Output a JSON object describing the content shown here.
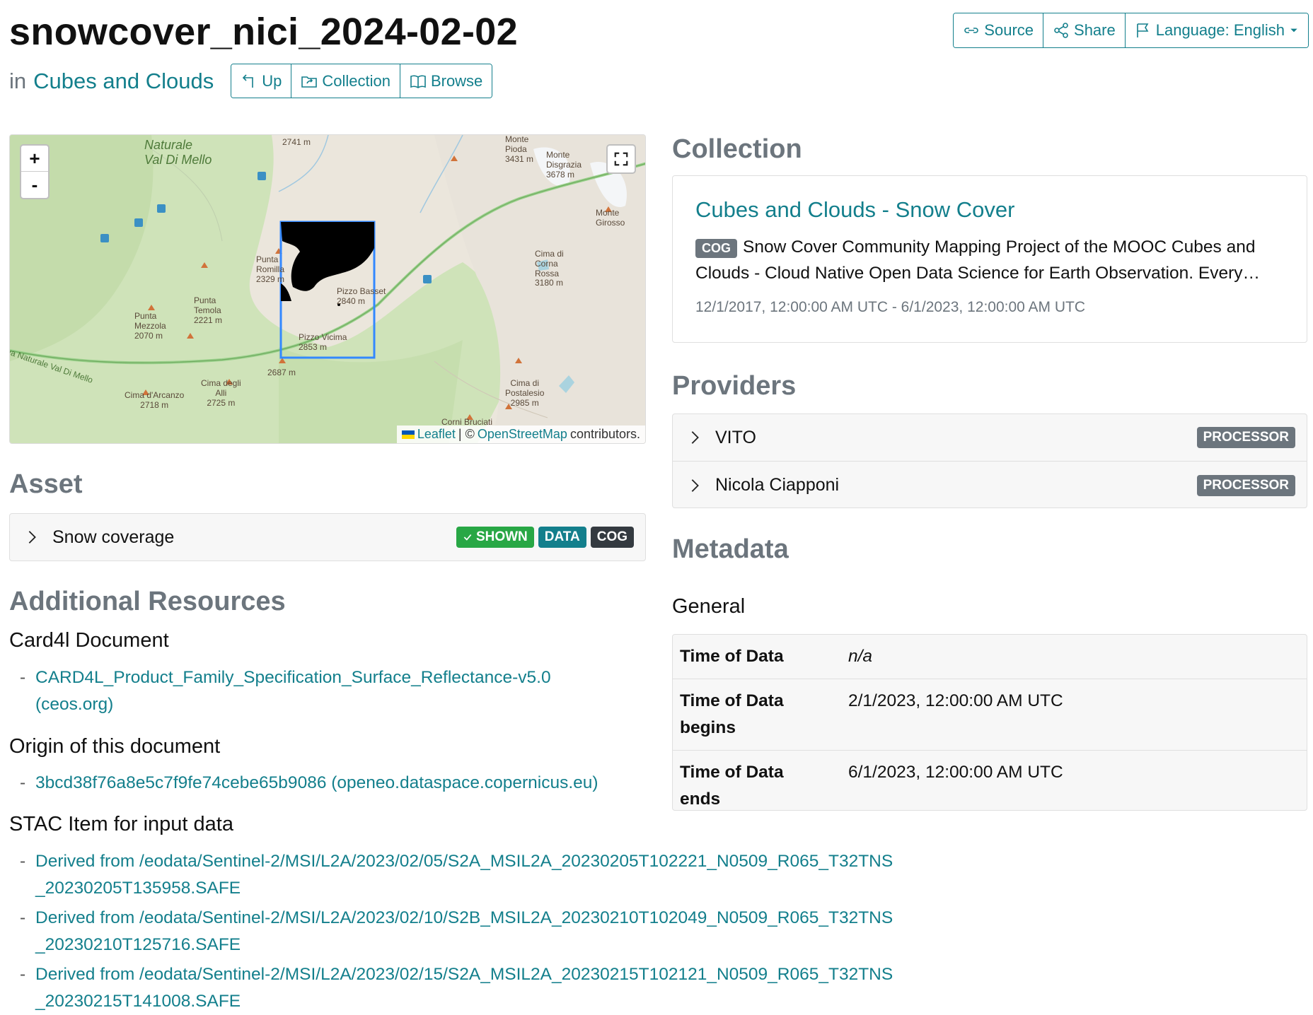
{
  "header": {
    "title": "snowcover_nici_2024-02-02",
    "in_label": "in",
    "catalog_link": "Cubes and Clouds",
    "nav": {
      "up": "Up",
      "collection": "Collection",
      "browse": "Browse"
    },
    "actions": {
      "source": "Source",
      "share": "Share",
      "language": "Language: English"
    }
  },
  "map": {
    "zoom_in": "+",
    "zoom_out": "-",
    "attribution": {
      "leaflet": "Leaflet",
      "separator": "| ©",
      "osm": "OpenStreetMap",
      "suffix": "contributors."
    },
    "labels": {
      "reserve": "Naturale\nVal Di Mello",
      "l2741": "2741 m",
      "piodaName": "Monte\nPioda",
      "pioda": "3431 m",
      "disgrazia": "Monte\nDisgrazia\n3678 m",
      "girosso": "Monte\nGirosso",
      "romilla": "Punta\nRomilla\n2329 m",
      "temola": "Punta\nTemola\n2221 m",
      "mezzola": "Punta\nMezzola\n2070 m",
      "basset": "Pizzo Basset\n2840 m",
      "vicima": "Pizzo Vicima\n2853 m",
      "corna": "Cima di\nCorna\nRossa\n3180 m",
      "riserva": "va Naturale Val Di Mello",
      "l2687": "2687 m",
      "arcanzo": "Cima d'Arcanzo\n2718 m",
      "alli": "Cima degli\nAlli\n2725 m",
      "postalesio": "Cima di\nPostalesio\n2985 m",
      "bruciati": "Corni Bruciati"
    }
  },
  "asset": {
    "heading": "Asset",
    "name": "Snow coverage",
    "badges": {
      "shown": "SHOWN",
      "data": "DATA",
      "cog": "COG"
    }
  },
  "resources": {
    "heading": "Additional Resources",
    "card4l": {
      "title": "Card4l Document",
      "link": "CARD4L_Product_Family_Specification_Surface_Reflectance-v5.0 (ceos.org)"
    },
    "origin": {
      "title": "Origin of this document",
      "link": "3bcd38f76a8e5c7f9fe74cebe65b9086 (openeo.dataspace.copernicus.eu)"
    },
    "stac": {
      "title": "STAC Item for input data",
      "links": [
        "Derived from /eodata/Sentinel-2/MSI/L2A/2023/02/05/S2A_MSIL2A_20230205T102221_N0509_R065_T32TNS_20230205T135958.SAFE",
        "Derived from /eodata/Sentinel-2/MSI/L2A/2023/02/10/S2B_MSIL2A_20230210T102049_N0509_R065_T32TNS_20230210T125716.SAFE",
        "Derived from /eodata/Sentinel-2/MSI/L2A/2023/02/15/S2A_MSIL2A_20230215T102121_N0509_R065_T32TNS_20230215T141008.SAFE"
      ]
    }
  },
  "collection": {
    "heading": "Collection",
    "title": "Cubes and Clouds - Snow Cover",
    "badge": "COG",
    "description": "Snow Cover Community Mapping Project of the MOOC Cubes and Clouds - Cloud Native Open Data Science for Earth Observation. Every…",
    "time_range": "12/1/2017, 12:00:00 AM UTC - 6/1/2023, 12:00:00 AM UTC"
  },
  "providers": {
    "heading": "Providers",
    "items": [
      {
        "name": "VITO",
        "role": "PROCESSOR"
      },
      {
        "name": "Nicola Ciapponi",
        "role": "PROCESSOR"
      }
    ]
  },
  "metadata": {
    "heading": "Metadata",
    "group": "General",
    "rows": [
      {
        "key": "Time of Data",
        "value": "n/a"
      },
      {
        "key": "Time of Data begins",
        "value": "2/1/2023, 12:00:00 AM UTC"
      },
      {
        "key": "Time of Data ends",
        "value": "6/1/2023, 12:00:00 AM UTC"
      }
    ]
  },
  "colors": {
    "accent": "#137f8c",
    "shown_badge": "#28a745",
    "dark_badge": "#343a40",
    "gray_badge": "#6c757d"
  }
}
